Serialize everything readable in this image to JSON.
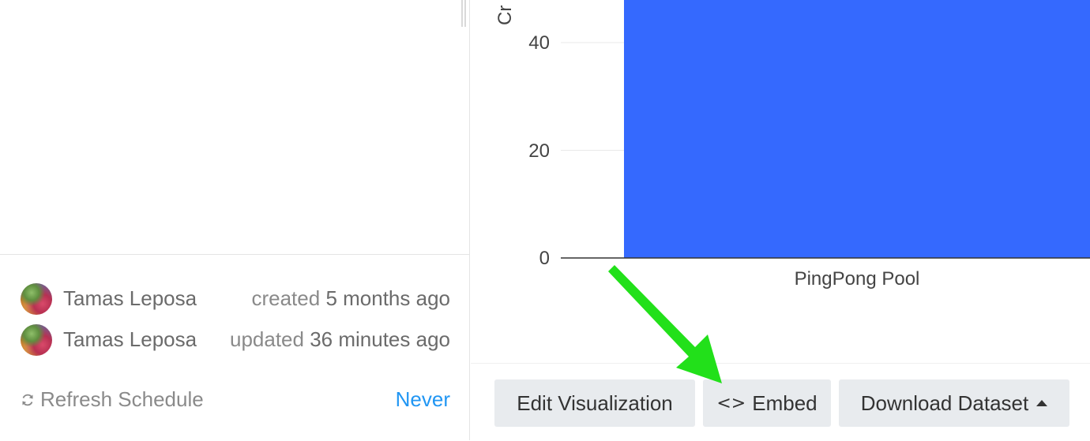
{
  "details": {
    "created": {
      "user": "Tamas Leposa",
      "action": "created",
      "when": "5 months ago"
    },
    "updated": {
      "user": "Tamas Leposa",
      "action": "updated",
      "when": "36 minutes ago"
    },
    "refresh": {
      "label": "Refresh Schedule",
      "value": "Never",
      "icon": "refresh-icon"
    }
  },
  "chart_data": {
    "type": "bar",
    "categories": [
      "PingPong Pool"
    ],
    "values": [
      60
    ],
    "ylabel": "Cr",
    "yticks": [
      "0",
      "20",
      "40"
    ],
    "ylim": [
      0,
      60
    ],
    "grid": true,
    "bar_color": "#3569fe"
  },
  "toolbar": {
    "edit_label": "Edit Visualization",
    "embed_label": "Embed",
    "embed_icon": "code-icon",
    "download_label": "Download Dataset",
    "download_icon": "caret-up-icon"
  },
  "colors": {
    "link": "#2196f3",
    "button_bg": "#e8ebee",
    "annotation_arrow": "#22e01a"
  }
}
